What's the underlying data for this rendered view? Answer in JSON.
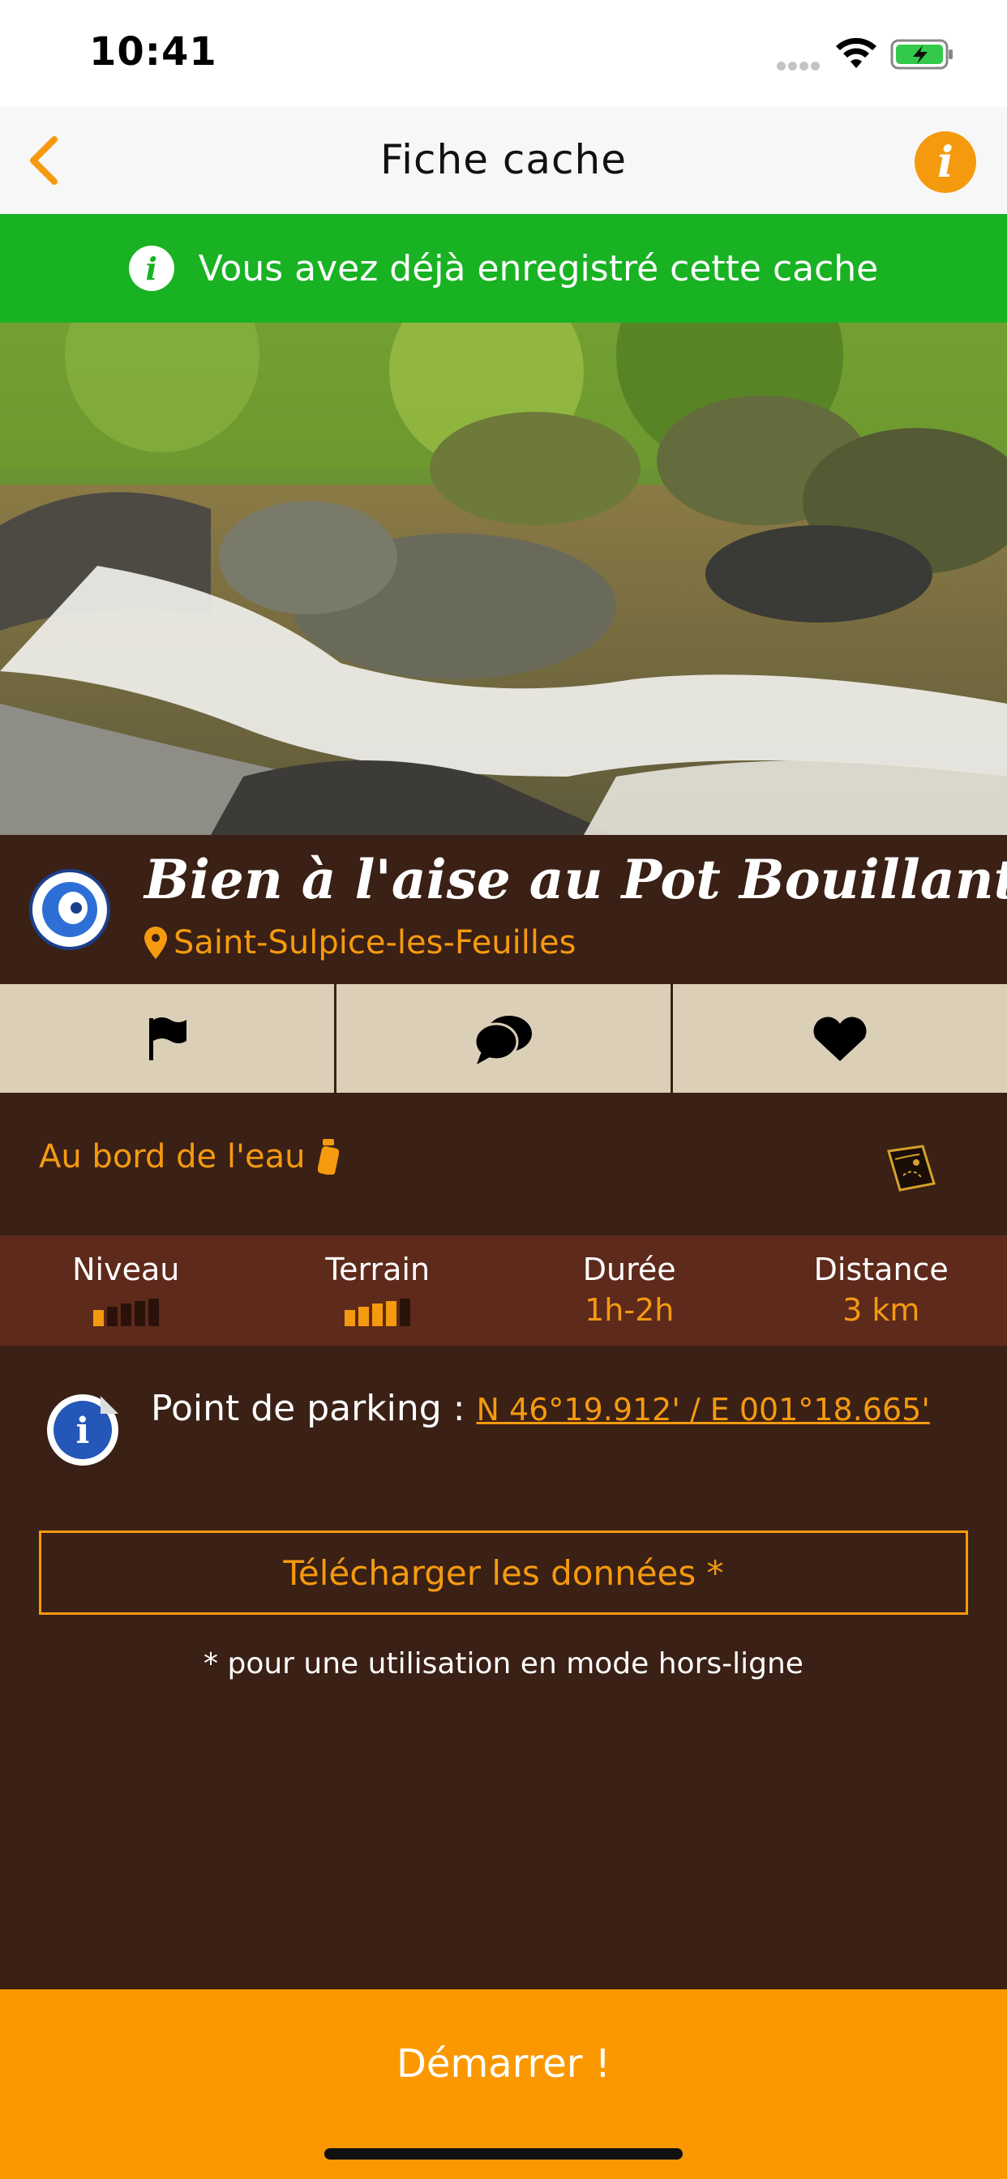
{
  "status_bar": {
    "time": "10:41"
  },
  "nav": {
    "title": "Fiche cache",
    "back_icon": "chevron-left-icon",
    "info_icon": "info-icon"
  },
  "banner": {
    "icon": "info-circle-icon",
    "text": "Vous avez déjà enregistré cette cache"
  },
  "cache": {
    "title": "Bien à l'aise au Pot Bouillant",
    "location": "Saint-Sulpice-les-Feuilles"
  },
  "tabs": [
    {
      "icon": "flag-icon"
    },
    {
      "icon": "chat-bubbles-icon"
    },
    {
      "icon": "heart-icon"
    }
  ],
  "theme": {
    "label": "Au bord de l'eau"
  },
  "stats": {
    "niveau": {
      "label": "Niveau",
      "level": 1,
      "max": 5
    },
    "terrain": {
      "label": "Terrain",
      "level": 4,
      "max": 5
    },
    "duree": {
      "label": "Durée",
      "value": "1h-2h"
    },
    "distance": {
      "label": "Distance",
      "value": "3 km"
    }
  },
  "parking": {
    "label": "Point de parking : ",
    "coords": "N 46°19.912' / E 001°18.665'"
  },
  "download": {
    "label": "Télécharger les données *",
    "note": "* pour une utilisation en mode hors-ligne"
  },
  "start": {
    "label": "Démarrer !"
  },
  "colors": {
    "accent": "#f59a0f",
    "banner": "#18b223",
    "background": "#3a2015",
    "stats_band": "#5e2a1b",
    "tabs": "#dccfb8"
  }
}
